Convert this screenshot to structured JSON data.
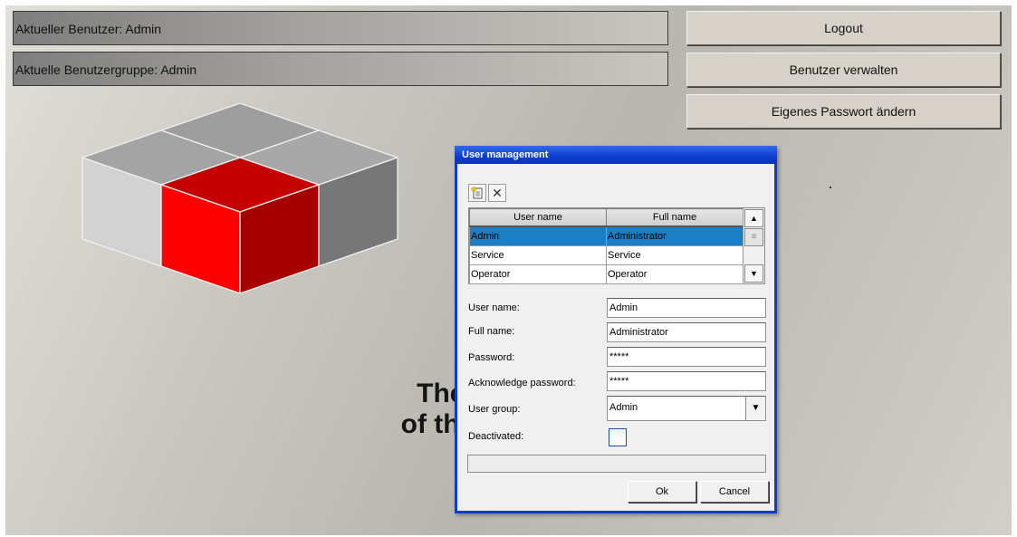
{
  "header": {
    "current_user": "Aktueller Benutzer: Admin",
    "current_group": "Aktuelle Benutzergruppe: Admin"
  },
  "buttons": {
    "logout": "Logout",
    "manage_users": "Benutzer verwalten",
    "change_password": "Eigenes Passwort ändern"
  },
  "main": {
    "headline_line1": "The main",
    "headline_line2": "of the visua"
  },
  "dialog": {
    "title": "User management",
    "toolbar": {
      "new_icon": "new-document-icon",
      "delete_icon": "delete-x-icon"
    },
    "table": {
      "columns": [
        "User name",
        "Full name"
      ],
      "rows": [
        [
          "Admin",
          "Administrator"
        ],
        [
          "Service",
          "Service"
        ],
        [
          "Operator",
          "Operator"
        ]
      ],
      "selected_row": 0
    },
    "form": {
      "user_name_label": "User name:",
      "user_name_value": "Admin",
      "full_name_label": "Full name:",
      "full_name_value": "Administrator",
      "password_label": "Password:",
      "password_value": "*****",
      "ack_password_label": "Acknowledge password:",
      "ack_password_value": "*****",
      "user_group_label": "User group:",
      "user_group_value": "Admin",
      "deactivated_label": "Deactivated:",
      "deactivated_checked": false
    },
    "ok_label": "Ok",
    "cancel_label": "Cancel"
  },
  "colors": {
    "dialog_title": "#0e3dcc",
    "selection": "#1b7fc6",
    "cube_red": "#ff0000"
  }
}
